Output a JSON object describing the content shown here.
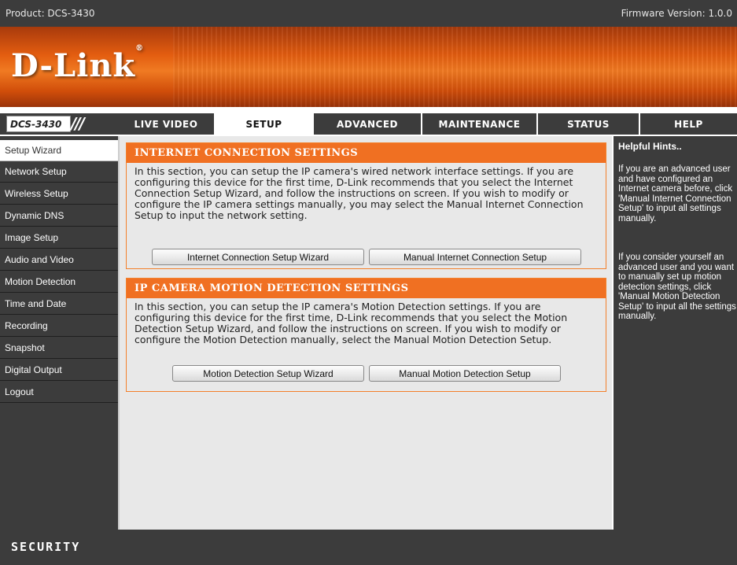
{
  "header": {
    "product": "Product: DCS-3430",
    "firmware": "Firmware Version: 1.0.0",
    "logo_text": "D-Link",
    "logo_mark": "®"
  },
  "model": {
    "name": "DCS-3430",
    "slashes": "///"
  },
  "nav": {
    "tabs": [
      "LIVE VIDEO",
      "SETUP",
      "ADVANCED",
      "MAINTENANCE",
      "STATUS",
      "HELP"
    ],
    "active": "SETUP"
  },
  "sidebar": {
    "items": [
      {
        "label": "Setup Wizard"
      },
      {
        "label": "Network Setup"
      },
      {
        "label": "Wireless Setup"
      },
      {
        "label": "Dynamic DNS"
      },
      {
        "label": "Image Setup"
      },
      {
        "label": "Audio and Video"
      },
      {
        "label": "Motion Detection"
      },
      {
        "label": "Time and Date"
      },
      {
        "label": "Recording"
      },
      {
        "label": "Snapshot"
      },
      {
        "label": "Digital Output"
      },
      {
        "label": "Logout"
      }
    ],
    "active": "Setup Wizard"
  },
  "internet": {
    "title": "INTERNET CONNECTION SETTINGS",
    "text": "In this section, you can setup the IP camera's wired network interface settings. If you are configuring this device for the first time, D-Link recommends that you select the Internet Connection Setup Wizard, and follow the instructions on screen. If you wish to modify or configure the IP camera settings manually, you may select the Manual Internet Connection Setup to input the network setting.",
    "wizard_button": "Internet Connection Setup Wizard",
    "manual_button": "Manual Internet Connection Setup"
  },
  "motion": {
    "title": "IP CAMERA MOTION DETECTION SETTINGS",
    "text": "In this section, you can setup the IP camera's Motion Detection settings. If you are configuring this device for the first time, D-Link recommends that you select the Motion Detection Setup Wizard, and follow the instructions on screen. If you wish to modify or configure the Motion Detection manually, select the Manual Motion Detection Setup.",
    "wizard_button": "Motion Detection Setup Wizard",
    "manual_button": "Manual Motion Detection Setup"
  },
  "hints": {
    "title": "Helpful Hints..",
    "para1": "If you are an advanced user and have configured an Internet camera before, click 'Manual Internet Connection Setup' to input all settings manually.",
    "para2": "If you consider yourself an advanced user and you want to manually set up motion detection settings, click 'Manual Motion Detection Setup' to input all the settings manually."
  },
  "footer": {
    "brand": "SECURITY"
  },
  "colors": {
    "accent": "#f07022",
    "dark": "#3c3c3c",
    "panel_bg": "#e8e8e8"
  }
}
